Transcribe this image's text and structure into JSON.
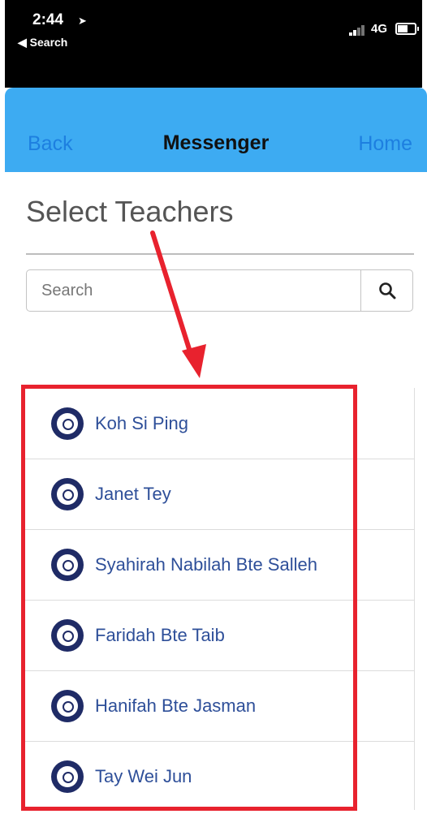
{
  "status_bar": {
    "time": "2:44",
    "back_app": "◀ Search",
    "network": "4G"
  },
  "nav": {
    "back": "Back",
    "title": "Messenger",
    "home": "Home"
  },
  "page": {
    "heading": "Select Teachers"
  },
  "search": {
    "placeholder": "Search"
  },
  "teachers": [
    {
      "name": "Koh Si Ping"
    },
    {
      "name": "Janet Tey"
    },
    {
      "name": "Syahirah Nabilah Bte Salleh"
    },
    {
      "name": "Faridah Bte Taib"
    },
    {
      "name": "Hanifah Bte Jasman"
    },
    {
      "name": "Tay Wei Jun"
    }
  ],
  "icons": {
    "search": "search-icon",
    "location": "location-arrow-icon",
    "signal": "signal-icon",
    "battery": "battery-icon",
    "avatar": "school-crest-icon",
    "annotation": "red-arrow-annotation"
  },
  "colors": {
    "nav_bg": "#3dabf2",
    "nav_link": "#1d7fe0",
    "teacher_name": "#2e4f99",
    "annotation": "#e8222e"
  }
}
